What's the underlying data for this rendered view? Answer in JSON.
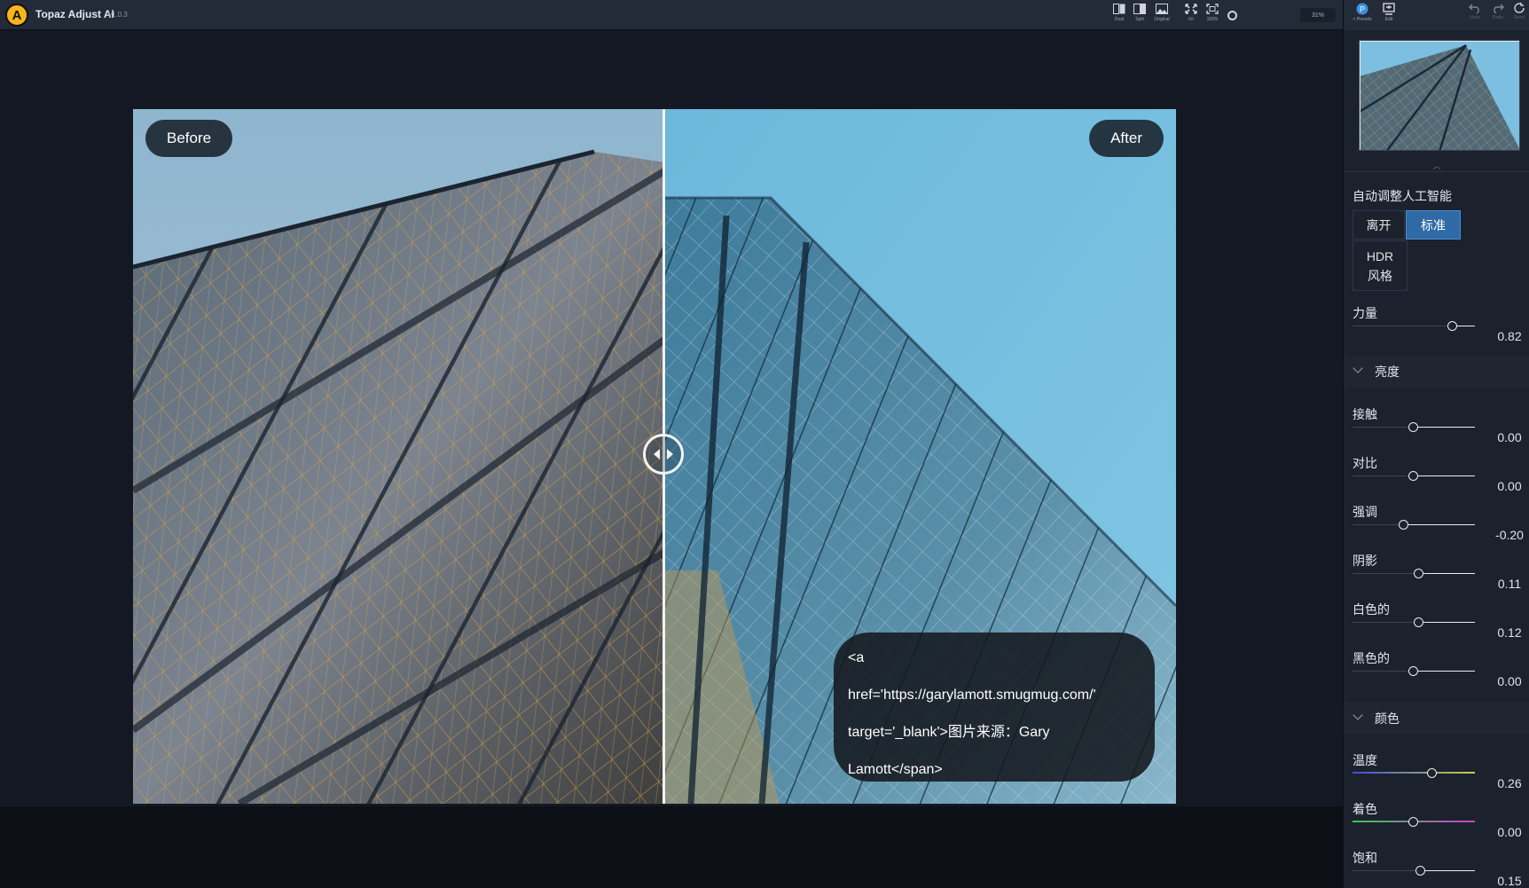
{
  "app": {
    "title": "Topaz Adjust AI",
    "version": "v1.0.3"
  },
  "toolbar": {
    "views": [
      {
        "label": "Dual",
        "icon": "dual-view-icon"
      },
      {
        "label": "Split",
        "icon": "split-view-icon"
      },
      {
        "label": "Original",
        "icon": "original-view-icon"
      },
      {
        "label": "Fit",
        "icon": "fit-icon"
      },
      {
        "label": "100%",
        "icon": "actual-size-icon"
      }
    ],
    "zoom": "31%"
  },
  "panel_tabs": [
    {
      "label": "< Presets",
      "icon": "presets-icon"
    },
    {
      "label": "Edit",
      "icon": "edit-icon"
    }
  ],
  "history": {
    "undo": "Undo",
    "redo": "Redo",
    "reset": "Reset"
  },
  "compare": {
    "before_label": "Before",
    "after_label": "After"
  },
  "credit": {
    "line1": "<a",
    "line2": "href='https://garylamott.smugmug.com/'",
    "line3": "target='_blank'>图片来源：Gary",
    "line4": "Lamott</span>"
  },
  "auto_ai": {
    "title": "自动调整人工智能",
    "modes": [
      "离开",
      "标准",
      "HDR风格"
    ],
    "selected": "标准"
  },
  "strength": {
    "label": "力量",
    "value": "0.82",
    "fraction": 0.82
  },
  "groups": {
    "brightness": {
      "title": "亮度",
      "sliders": [
        {
          "label": "接触",
          "value": "0.00",
          "fraction": 0.5
        },
        {
          "label": "对比",
          "value": "0.00",
          "fraction": 0.5
        },
        {
          "label": "强调",
          "value": "-0.20",
          "fraction": 0.42
        },
        {
          "label": "阴影",
          "value": "0.11",
          "fraction": 0.54
        },
        {
          "label": "白色的",
          "value": "0.12",
          "fraction": 0.54
        },
        {
          "label": "黑色的",
          "value": "0.00",
          "fraction": 0.5
        }
      ]
    },
    "color": {
      "title": "颜色",
      "sliders": [
        {
          "label": "温度",
          "value": "0.26",
          "fraction": 0.65
        },
        {
          "label": "着色",
          "value": "0.00",
          "fraction": 0.5
        },
        {
          "label": "饱和",
          "value": "0.15",
          "fraction": 0.56
        }
      ]
    }
  }
}
